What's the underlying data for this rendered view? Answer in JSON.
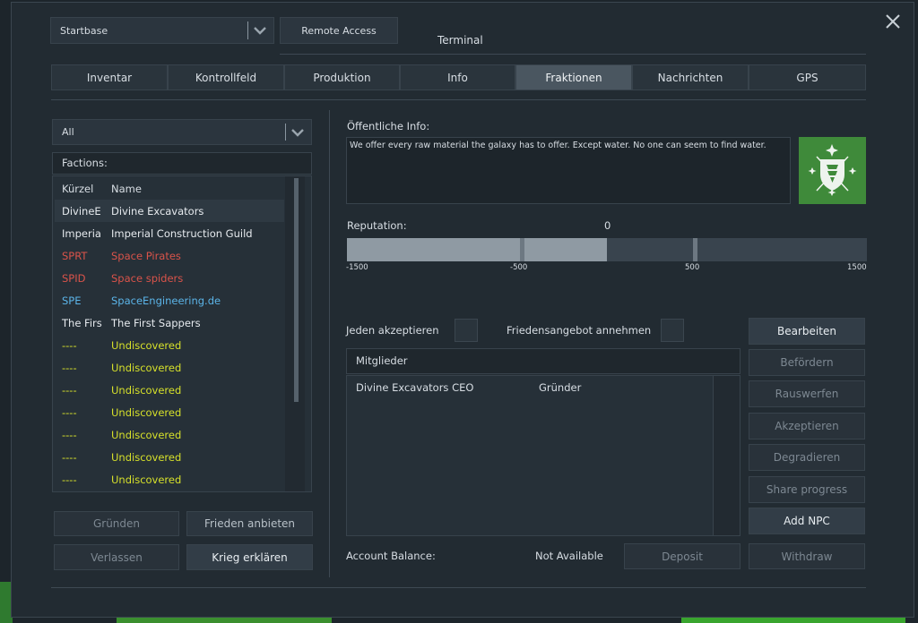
{
  "header": {
    "base_dropdown": "Startbase",
    "remote_access": "Remote Access",
    "title": "Terminal"
  },
  "tabs": [
    {
      "label": "Inventar"
    },
    {
      "label": "Kontrollfeld"
    },
    {
      "label": "Produktion"
    },
    {
      "label": "Info"
    },
    {
      "label": "Fraktionen",
      "active": true
    },
    {
      "label": "Nachrichten"
    },
    {
      "label": "GPS"
    }
  ],
  "left": {
    "filter": "All",
    "factions_header": "Factions:",
    "columns": {
      "abbr": "Kürzel",
      "name": "Name"
    },
    "rows": [
      {
        "abbr": "DivineE",
        "name": "Divine Excavators",
        "color": "#e6eaee",
        "selected": true
      },
      {
        "abbr": "Imperia",
        "name": "Imperial Construction Guild",
        "color": "#e6eaee"
      },
      {
        "abbr": "SPRT",
        "name": "Space Pirates",
        "color": "#d9534a"
      },
      {
        "abbr": "SPID",
        "name": "Space spiders",
        "color": "#d9534a"
      },
      {
        "abbr": "SPE",
        "name": "SpaceEngineering.de",
        "color": "#5bb4e8"
      },
      {
        "abbr": "The Firs",
        "name": "The First Sappers",
        "color": "#e6eaee"
      },
      {
        "abbr": "----",
        "name": "Undiscovered",
        "color": "#d6e02a"
      },
      {
        "abbr": "----",
        "name": "Undiscovered",
        "color": "#d6e02a"
      },
      {
        "abbr": "----",
        "name": "Undiscovered",
        "color": "#d6e02a"
      },
      {
        "abbr": "----",
        "name": "Undiscovered",
        "color": "#d6e02a"
      },
      {
        "abbr": "----",
        "name": "Undiscovered",
        "color": "#d6e02a"
      },
      {
        "abbr": "----",
        "name": "Undiscovered",
        "color": "#d6e02a"
      },
      {
        "abbr": "----",
        "name": "Undiscovered",
        "color": "#d6e02a"
      }
    ],
    "buttons": {
      "found": "Gründen",
      "offer_peace": "Frieden anbieten",
      "leave": "Verlassen",
      "declare_war": "Krieg erklären"
    }
  },
  "right": {
    "public_info_label": "Öffentliche Info:",
    "public_info_text": "We offer every raw material the galaxy has to offer. Except water. No one can seem to find water.",
    "reputation_label": "Reputation:",
    "reputation_value": "0",
    "reputation_fill_fraction": 0.5,
    "scale": [
      "-1500",
      "-500",
      "500",
      "1500"
    ],
    "accept_all": "Jeden akzeptieren",
    "accept_peace": "Friedensangebot annehmen",
    "members_header": "Mitglieder",
    "members": [
      {
        "name": "Divine Excavators CEO",
        "role": "Gründer"
      }
    ],
    "actions": {
      "edit": "Bearbeiten",
      "promote": "Befördern",
      "kick": "Rauswerfen",
      "accept": "Akzeptieren",
      "demote": "Degradieren",
      "share": "Share progress",
      "add_npc": "Add NPC"
    },
    "account_balance_label": "Account Balance:",
    "account_balance_value": "Not Available",
    "deposit": "Deposit",
    "withdraw": "Withdraw"
  },
  "colors": {
    "accent_logo_bg": "#3f8a3a",
    "hostile": "#d9534a",
    "friendly_link": "#5bb4e8",
    "undiscovered": "#d6e02a"
  },
  "icons": {
    "close": "close-icon",
    "dropdown": "chevron-down-icon",
    "faction_logo": "shield-emblem-icon"
  }
}
